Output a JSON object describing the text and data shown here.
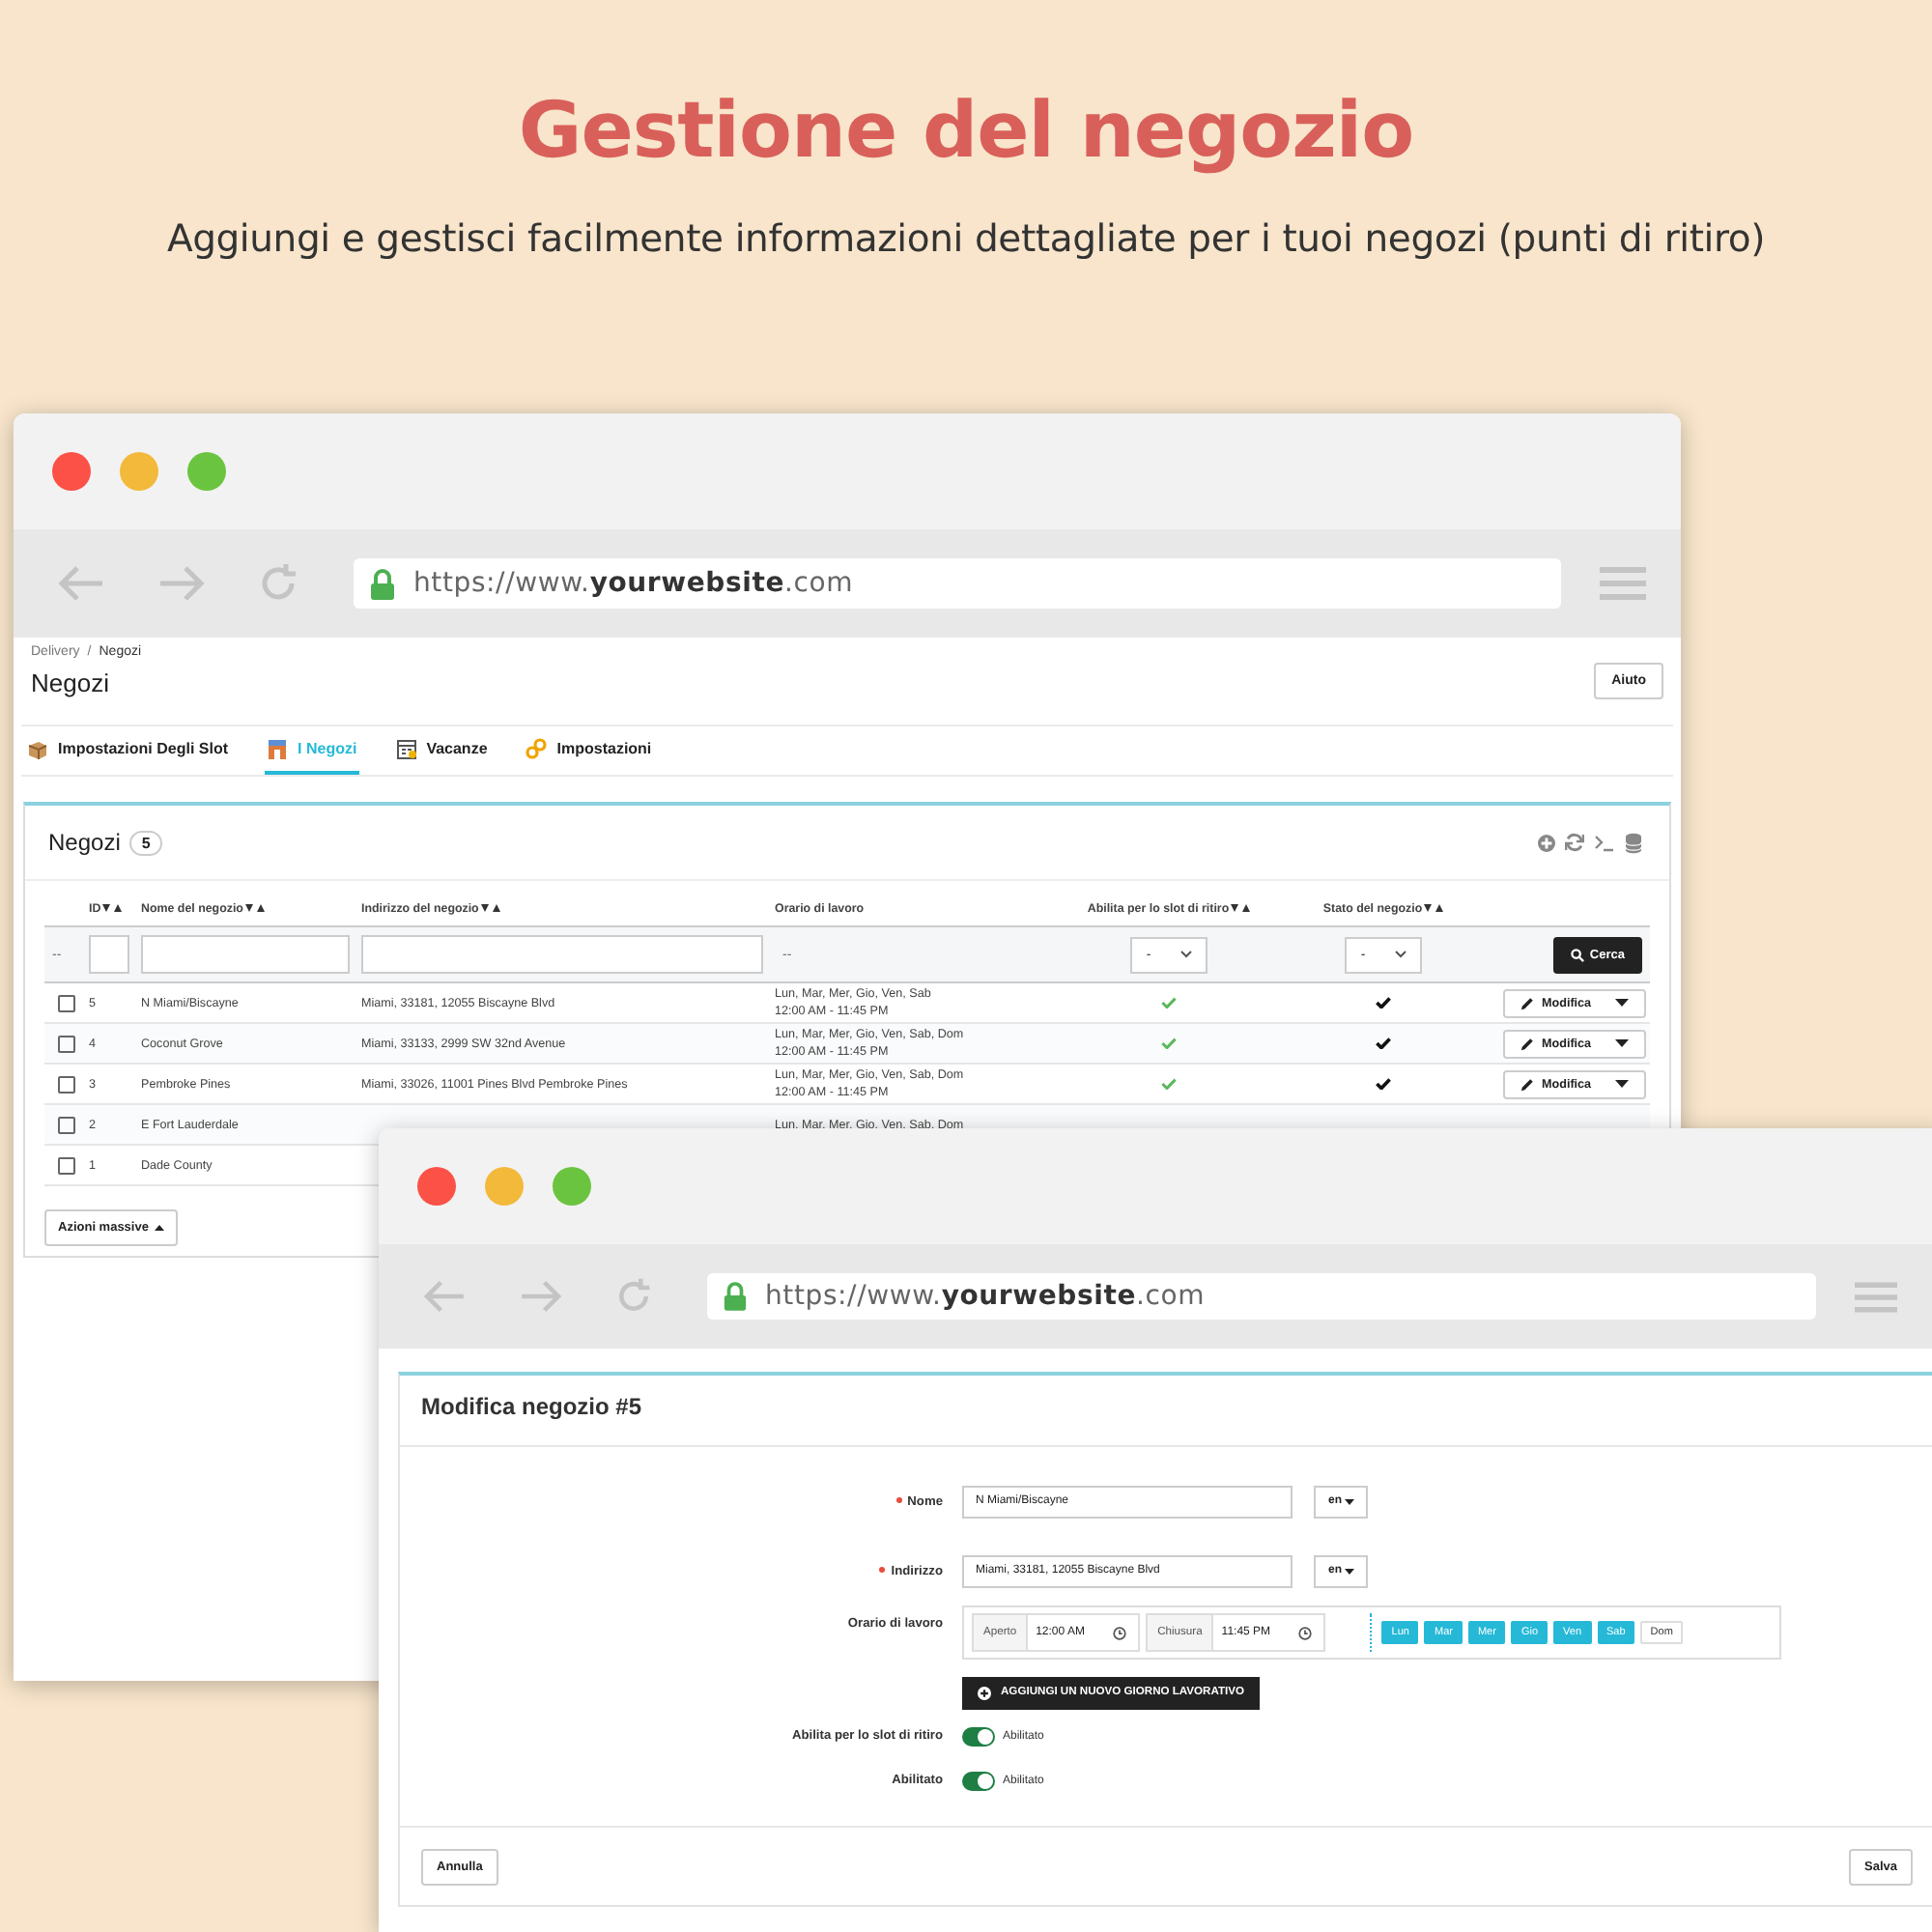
{
  "heading": {
    "title": "Gestione del negozio",
    "subtitle": "Aggiungi e gestisci facilmente informazioni dettagliate per i tuoi negozi (punti di ritiro)"
  },
  "list_window": {
    "url": "https://www.**yourwebsite**.com",
    "breadcrumb": {
      "separator": "/",
      "items": [
        "Delivery",
        "Negozi"
      ]
    },
    "page_title": "Negozi",
    "help_button": "Aiuto",
    "tabs": [
      {
        "label": "Impostazioni Degli Slot",
        "kind": "slots",
        "selected": false
      },
      {
        "label": "I Negozi",
        "kind": "stores",
        "selected": true
      },
      {
        "label": "Vacanze",
        "kind": "holidays",
        "selected": false
      },
      {
        "label": "Impostazioni",
        "kind": "settings",
        "selected": false
      }
    ],
    "panel": {
      "title": "Negozi",
      "count": "5",
      "columns": [
        {
          "label": "ID",
          "sortable": true
        },
        {
          "label": "Nome del negozio",
          "sortable": true
        },
        {
          "label": "Indirizzo del negozio",
          "sortable": true
        },
        {
          "label": "Orario di lavoro",
          "sortable": false
        },
        {
          "label": "Abilita per lo slot di ritiro",
          "sortable": true
        },
        {
          "label": "Stato del negozio",
          "sortable": true
        }
      ],
      "filter": {
        "id_text": "--",
        "hours_text": "--",
        "pickup_select": "-",
        "status_select": "-",
        "search_button": "Cerca"
      },
      "rows": [
        {
          "checked": false,
          "id": "5",
          "name": "N Miami/Biscayne",
          "address": "Miami, 33181, 12055 Biscayne Blvd",
          "hours": [
            "Lun, Mar, Mer, Gio, Ven, Sab",
            "12:00 AM - 11:45 PM"
          ],
          "pickup": true,
          "active": true,
          "action": "Modifica"
        },
        {
          "checked": false,
          "id": "4",
          "name": "Coconut Grove",
          "address": "Miami, 33133, 2999 SW 32nd Avenue",
          "hours": [
            "Lun, Mar, Mer, Gio, Ven, Sab, Dom",
            "12:00 AM - 11:45 PM"
          ],
          "pickup": true,
          "active": true,
          "action": "Modifica"
        },
        {
          "checked": false,
          "id": "3",
          "name": "Pembroke Pines",
          "address": "Miami, 33026, 11001 Pines Blvd Pembroke Pines",
          "hours": [
            "Lun, Mar, Mer, Gio, Ven, Sab, Dom",
            "12:00 AM - 11:45 PM"
          ],
          "pickup": true,
          "active": true,
          "action": "Modifica"
        },
        {
          "checked": false,
          "id": "2",
          "name": "E Fort Lauderdale",
          "hours": [
            "Lun, Mar, Mer, Gio, Ven, Sab, Dom"
          ]
        },
        {
          "checked": false,
          "id": "1",
          "name": "Dade County"
        }
      ],
      "bulk_button": "Azioni massive"
    }
  },
  "edit_window": {
    "url": "https://www.**yourwebsite**.com",
    "title": "Modifica negozio #5",
    "fields": [
      {
        "kind": "text",
        "label": "Nome",
        "required": true,
        "value": "N Miami/Biscayne",
        "lang": "en"
      },
      {
        "kind": "text",
        "label": "Indirizzo",
        "required": true,
        "value": "Miami, 33181, 12055 Biscayne Blvd",
        "lang": "en"
      },
      {
        "kind": "hours",
        "label": "Orario di lavoro",
        "open_label": "Aperto",
        "open": "12:00 AM",
        "close_label": "Chiusura",
        "close": "11:45 PM",
        "days": [
          {
            "label": "Lun",
            "selected": true
          },
          {
            "label": "Mar",
            "selected": true
          },
          {
            "label": "Mer",
            "selected": true
          },
          {
            "label": "Gio",
            "selected": true
          },
          {
            "label": "Ven",
            "selected": true
          },
          {
            "label": "Sab",
            "selected": true
          },
          {
            "label": "Dom",
            "selected": false
          }
        ]
      },
      {
        "kind": "button",
        "label": "AGGIUNGI UN NUOVO GIORNO LAVORATIVO"
      },
      {
        "kind": "toggle",
        "label": "Abilita per lo slot di ritiro",
        "on": true,
        "state_text": "Abilitato"
      },
      {
        "kind": "toggle",
        "label": "Abilitato",
        "on": true,
        "state_text": "Abilitato"
      }
    ],
    "cancel_button": "Annulla",
    "save_button": "Salva"
  }
}
